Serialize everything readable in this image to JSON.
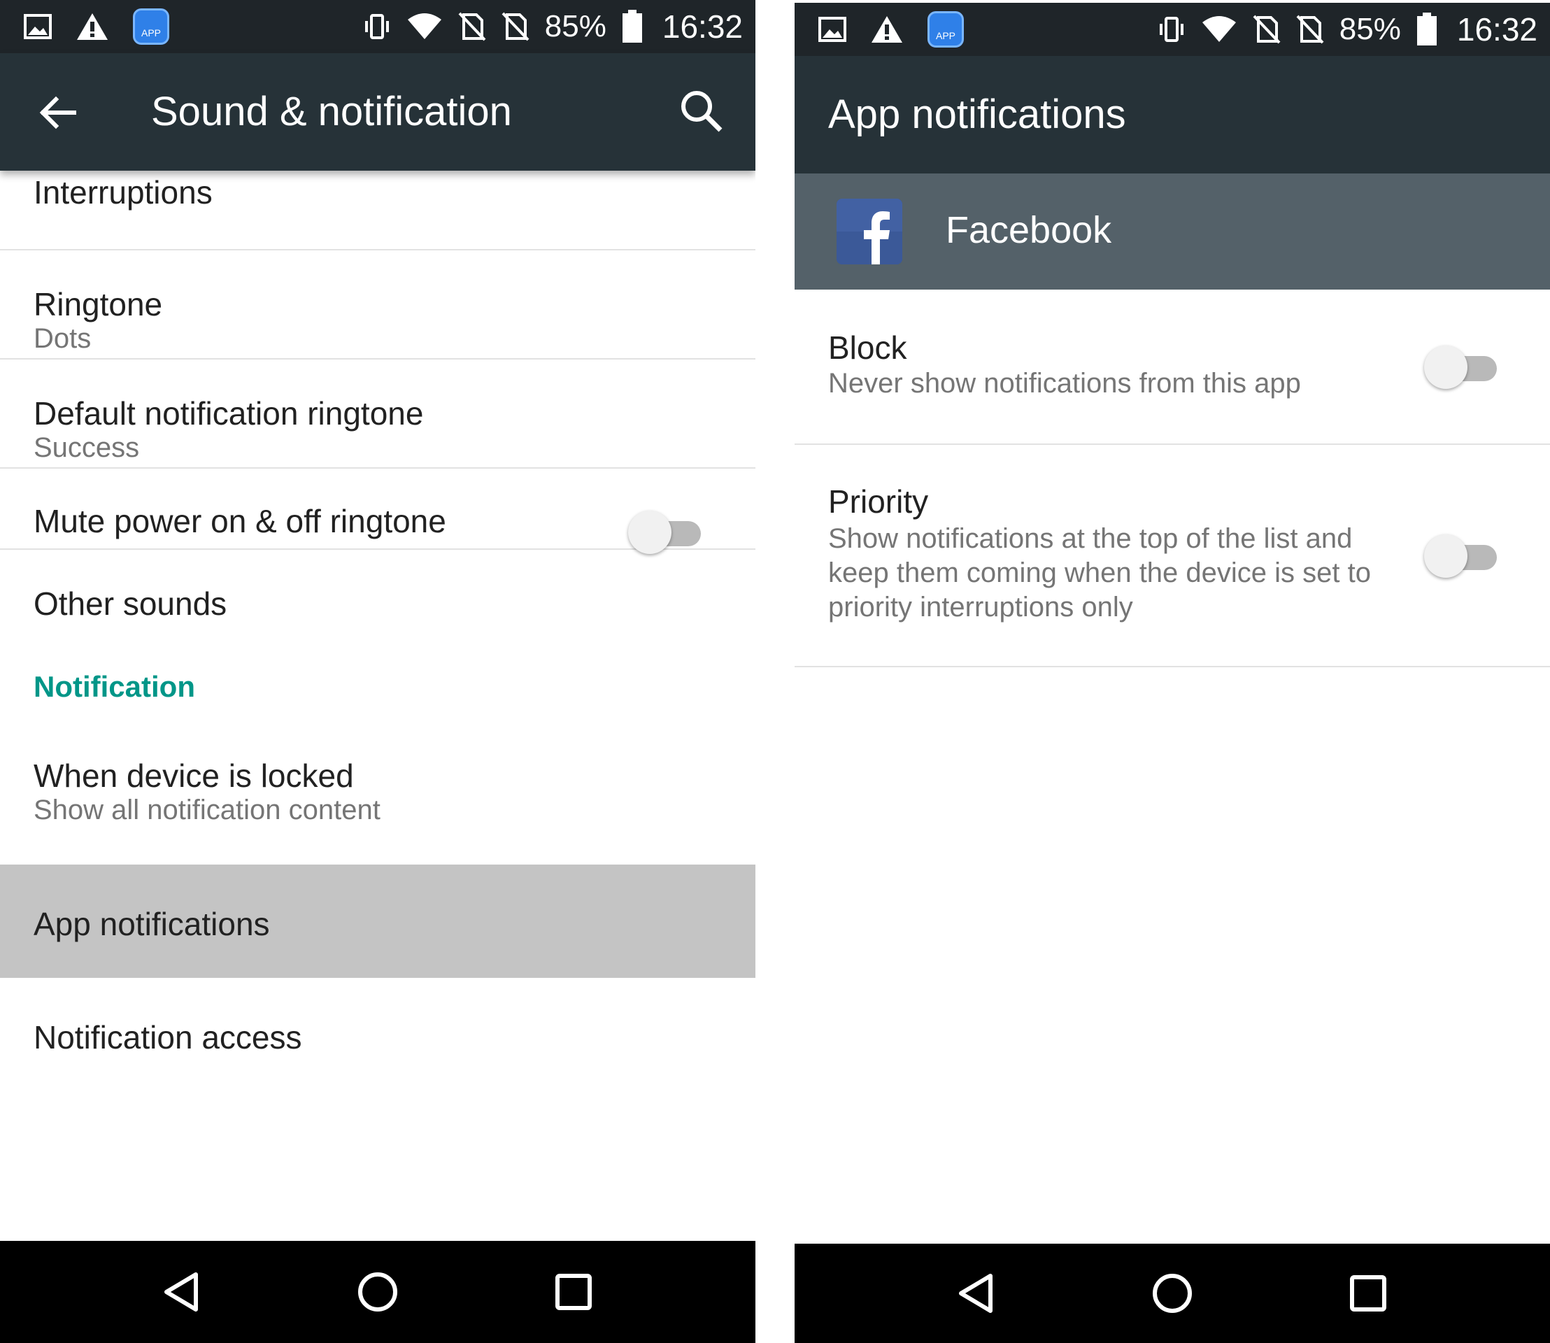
{
  "left": {
    "status": {
      "battery": "85%",
      "time": "16:32",
      "app_badge": "APP"
    },
    "app_bar": {
      "title": "Sound & notification"
    },
    "items": [
      {
        "title": "Interruptions"
      },
      {
        "title": "Ringtone",
        "subtitle": "Dots"
      },
      {
        "title": "Default notification ringtone",
        "subtitle": "Success"
      },
      {
        "title": "Mute power on & off ringtone",
        "switch_on": false
      },
      {
        "title": "Other sounds"
      }
    ],
    "section": {
      "header": "Notification"
    },
    "notif_items": [
      {
        "title": "When device is locked",
        "subtitle": "Show all notification content"
      },
      {
        "title": "App notifications"
      },
      {
        "title": "Notification access"
      }
    ]
  },
  "right": {
    "status": {
      "battery": "85%",
      "time": "16:32",
      "app_badge": "APP"
    },
    "app_bar": {
      "title": "App notifications"
    },
    "app": {
      "name": "Facebook",
      "logo_letter": "f",
      "brand_color": "#3b5998"
    },
    "items": [
      {
        "title": "Block",
        "subtitle": "Never show notifications from this app",
        "switch_on": false
      },
      {
        "title": "Priority",
        "subtitle": "Show notifications at the top of the list and keep them coming when the device is set to priority interruptions only",
        "switch_on": false
      }
    ]
  },
  "colors": {
    "app_bar": "#263238",
    "status_bar": "#1f2529",
    "accent": "#009688",
    "highlight": "#c4c4c4"
  }
}
